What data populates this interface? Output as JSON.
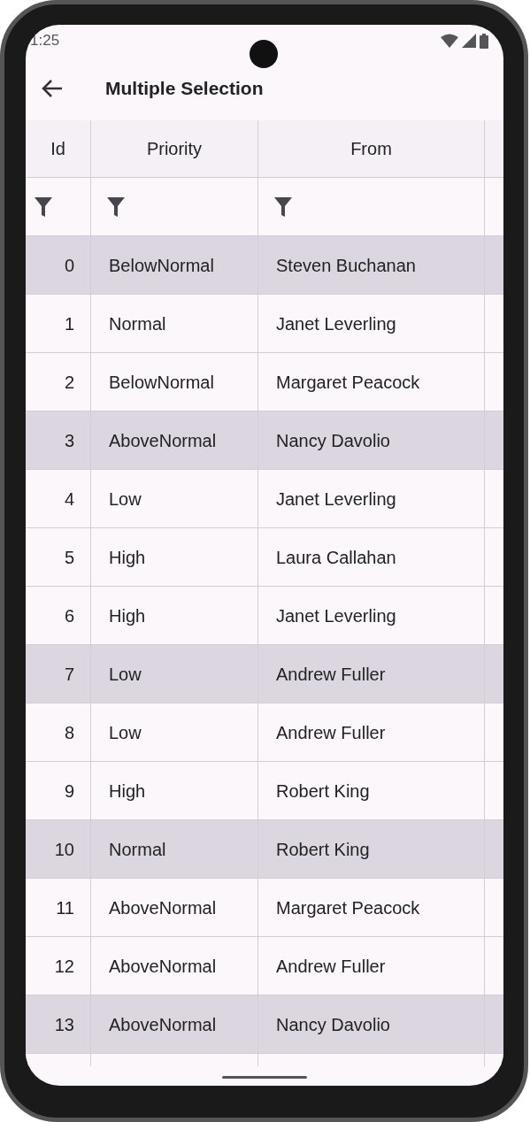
{
  "status_bar": {
    "time": "1:25"
  },
  "app_bar": {
    "title": "Multiple Selection"
  },
  "table": {
    "columns": [
      "Id",
      "Priority",
      "From"
    ],
    "rows": [
      {
        "id": "0",
        "priority": "BelowNormal",
        "from": "Steven Buchanan",
        "selected": true
      },
      {
        "id": "1",
        "priority": "Normal",
        "from": "Janet Leverling",
        "selected": false
      },
      {
        "id": "2",
        "priority": "BelowNormal",
        "from": "Margaret Peacock",
        "selected": false
      },
      {
        "id": "3",
        "priority": "AboveNormal",
        "from": "Nancy Davolio",
        "selected": true
      },
      {
        "id": "4",
        "priority": "Low",
        "from": "Janet Leverling",
        "selected": false
      },
      {
        "id": "5",
        "priority": "High",
        "from": "Laura Callahan",
        "selected": false
      },
      {
        "id": "6",
        "priority": "High",
        "from": "Janet Leverling",
        "selected": false
      },
      {
        "id": "7",
        "priority": "Low",
        "from": "Andrew Fuller",
        "selected": true
      },
      {
        "id": "8",
        "priority": "Low",
        "from": "Andrew Fuller",
        "selected": false
      },
      {
        "id": "9",
        "priority": "High",
        "from": "Robert King",
        "selected": false
      },
      {
        "id": "10",
        "priority": "Normal",
        "from": "Robert King",
        "selected": true
      },
      {
        "id": "11",
        "priority": "AboveNormal",
        "from": "Margaret Peacock",
        "selected": false
      },
      {
        "id": "12",
        "priority": "AboveNormal",
        "from": "Andrew Fuller",
        "selected": false
      },
      {
        "id": "13",
        "priority": "AboveNormal",
        "from": "Nancy Davolio",
        "selected": true
      }
    ]
  }
}
